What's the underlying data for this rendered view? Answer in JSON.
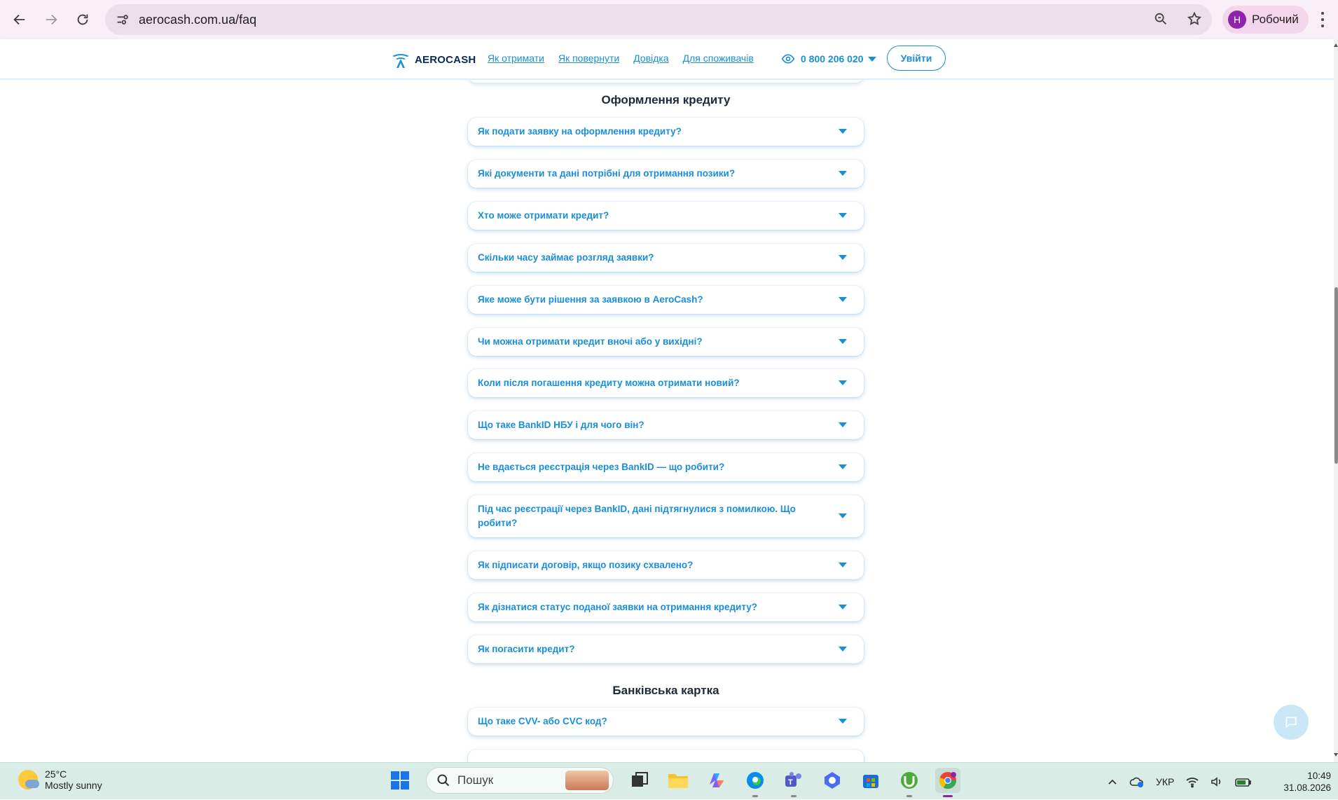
{
  "browser": {
    "url": "aerocash.com.ua/faq",
    "profile_initial": "Н",
    "profile_name": "Робочий"
  },
  "header": {
    "brand": "AEROCASH",
    "menu": [
      "Як отримати",
      "Як повернути",
      "Довідка",
      "Для споживачів"
    ],
    "phone": "0 800 206 020",
    "login": "Увійти"
  },
  "sections": [
    {
      "title": "Оформлення кредиту",
      "items": [
        "Як подати заявку на оформлення кредиту?",
        "Які документи та дані потрібні для отримання позики?",
        "Хто може отримати кредит?",
        "Скільки часу займає розгляд заявки?",
        "Яке може бути рішення за заявкою в AeroCash?",
        "Чи можна отримати кредит вночі або у вихідні?",
        "Коли після погашення кредиту можна отримати новий?",
        "Що таке BankID НБУ і для чого він?",
        "Не вдається реєстрація через BankID — що робити?",
        "Під час реєстрації через BankID, дані підтягнулися з помилкою. Що робити?",
        "Як підписати договір, якщо позику схвалено?",
        "Як дізнатися статус поданої заявки на отримання кредиту?",
        "Як погасити кредит?"
      ]
    },
    {
      "title": "Банківська картка",
      "items": [
        "Що таке CVV- або CVC код?"
      ]
    }
  ],
  "taskbar": {
    "temp": "25°C",
    "weather": "Mostly sunny",
    "search": "Пошук",
    "lang": "УКР",
    "time": "10:49",
    "date": "31.08.2026"
  }
}
